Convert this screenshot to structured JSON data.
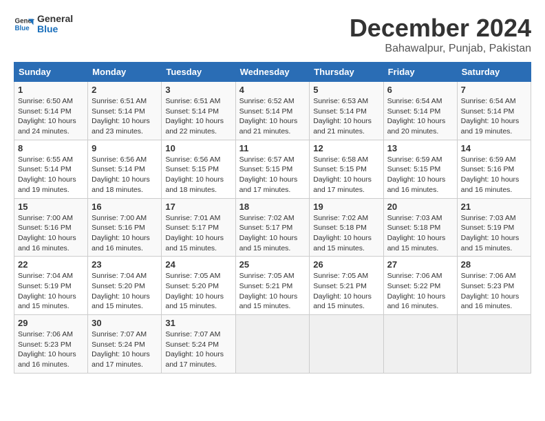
{
  "logo": {
    "line1": "General",
    "line2": "Blue"
  },
  "title": "December 2024",
  "location": "Bahawalpur, Punjab, Pakistan",
  "days_header": [
    "Sunday",
    "Monday",
    "Tuesday",
    "Wednesday",
    "Thursday",
    "Friday",
    "Saturday"
  ],
  "weeks": [
    [
      {
        "day": "1",
        "sunrise": "Sunrise: 6:50 AM",
        "sunset": "Sunset: 5:14 PM",
        "daylight": "Daylight: 10 hours and 24 minutes."
      },
      {
        "day": "2",
        "sunrise": "Sunrise: 6:51 AM",
        "sunset": "Sunset: 5:14 PM",
        "daylight": "Daylight: 10 hours and 23 minutes."
      },
      {
        "day": "3",
        "sunrise": "Sunrise: 6:51 AM",
        "sunset": "Sunset: 5:14 PM",
        "daylight": "Daylight: 10 hours and 22 minutes."
      },
      {
        "day": "4",
        "sunrise": "Sunrise: 6:52 AM",
        "sunset": "Sunset: 5:14 PM",
        "daylight": "Daylight: 10 hours and 21 minutes."
      },
      {
        "day": "5",
        "sunrise": "Sunrise: 6:53 AM",
        "sunset": "Sunset: 5:14 PM",
        "daylight": "Daylight: 10 hours and 21 minutes."
      },
      {
        "day": "6",
        "sunrise": "Sunrise: 6:54 AM",
        "sunset": "Sunset: 5:14 PM",
        "daylight": "Daylight: 10 hours and 20 minutes."
      },
      {
        "day": "7",
        "sunrise": "Sunrise: 6:54 AM",
        "sunset": "Sunset: 5:14 PM",
        "daylight": "Daylight: 10 hours and 19 minutes."
      }
    ],
    [
      {
        "day": "8",
        "sunrise": "Sunrise: 6:55 AM",
        "sunset": "Sunset: 5:14 PM",
        "daylight": "Daylight: 10 hours and 19 minutes."
      },
      {
        "day": "9",
        "sunrise": "Sunrise: 6:56 AM",
        "sunset": "Sunset: 5:14 PM",
        "daylight": "Daylight: 10 hours and 18 minutes."
      },
      {
        "day": "10",
        "sunrise": "Sunrise: 6:56 AM",
        "sunset": "Sunset: 5:15 PM",
        "daylight": "Daylight: 10 hours and 18 minutes."
      },
      {
        "day": "11",
        "sunrise": "Sunrise: 6:57 AM",
        "sunset": "Sunset: 5:15 PM",
        "daylight": "Daylight: 10 hours and 17 minutes."
      },
      {
        "day": "12",
        "sunrise": "Sunrise: 6:58 AM",
        "sunset": "Sunset: 5:15 PM",
        "daylight": "Daylight: 10 hours and 17 minutes."
      },
      {
        "day": "13",
        "sunrise": "Sunrise: 6:59 AM",
        "sunset": "Sunset: 5:15 PM",
        "daylight": "Daylight: 10 hours and 16 minutes."
      },
      {
        "day": "14",
        "sunrise": "Sunrise: 6:59 AM",
        "sunset": "Sunset: 5:16 PM",
        "daylight": "Daylight: 10 hours and 16 minutes."
      }
    ],
    [
      {
        "day": "15",
        "sunrise": "Sunrise: 7:00 AM",
        "sunset": "Sunset: 5:16 PM",
        "daylight": "Daylight: 10 hours and 16 minutes."
      },
      {
        "day": "16",
        "sunrise": "Sunrise: 7:00 AM",
        "sunset": "Sunset: 5:16 PM",
        "daylight": "Daylight: 10 hours and 16 minutes."
      },
      {
        "day": "17",
        "sunrise": "Sunrise: 7:01 AM",
        "sunset": "Sunset: 5:17 PM",
        "daylight": "Daylight: 10 hours and 15 minutes."
      },
      {
        "day": "18",
        "sunrise": "Sunrise: 7:02 AM",
        "sunset": "Sunset: 5:17 PM",
        "daylight": "Daylight: 10 hours and 15 minutes."
      },
      {
        "day": "19",
        "sunrise": "Sunrise: 7:02 AM",
        "sunset": "Sunset: 5:18 PM",
        "daylight": "Daylight: 10 hours and 15 minutes."
      },
      {
        "day": "20",
        "sunrise": "Sunrise: 7:03 AM",
        "sunset": "Sunset: 5:18 PM",
        "daylight": "Daylight: 10 hours and 15 minutes."
      },
      {
        "day": "21",
        "sunrise": "Sunrise: 7:03 AM",
        "sunset": "Sunset: 5:19 PM",
        "daylight": "Daylight: 10 hours and 15 minutes."
      }
    ],
    [
      {
        "day": "22",
        "sunrise": "Sunrise: 7:04 AM",
        "sunset": "Sunset: 5:19 PM",
        "daylight": "Daylight: 10 hours and 15 minutes."
      },
      {
        "day": "23",
        "sunrise": "Sunrise: 7:04 AM",
        "sunset": "Sunset: 5:20 PM",
        "daylight": "Daylight: 10 hours and 15 minutes."
      },
      {
        "day": "24",
        "sunrise": "Sunrise: 7:05 AM",
        "sunset": "Sunset: 5:20 PM",
        "daylight": "Daylight: 10 hours and 15 minutes."
      },
      {
        "day": "25",
        "sunrise": "Sunrise: 7:05 AM",
        "sunset": "Sunset: 5:21 PM",
        "daylight": "Daylight: 10 hours and 15 minutes."
      },
      {
        "day": "26",
        "sunrise": "Sunrise: 7:05 AM",
        "sunset": "Sunset: 5:21 PM",
        "daylight": "Daylight: 10 hours and 15 minutes."
      },
      {
        "day": "27",
        "sunrise": "Sunrise: 7:06 AM",
        "sunset": "Sunset: 5:22 PM",
        "daylight": "Daylight: 10 hours and 16 minutes."
      },
      {
        "day": "28",
        "sunrise": "Sunrise: 7:06 AM",
        "sunset": "Sunset: 5:23 PM",
        "daylight": "Daylight: 10 hours and 16 minutes."
      }
    ],
    [
      {
        "day": "29",
        "sunrise": "Sunrise: 7:06 AM",
        "sunset": "Sunset: 5:23 PM",
        "daylight": "Daylight: 10 hours and 16 minutes."
      },
      {
        "day": "30",
        "sunrise": "Sunrise: 7:07 AM",
        "sunset": "Sunset: 5:24 PM",
        "daylight": "Daylight: 10 hours and 17 minutes."
      },
      {
        "day": "31",
        "sunrise": "Sunrise: 7:07 AM",
        "sunset": "Sunset: 5:24 PM",
        "daylight": "Daylight: 10 hours and 17 minutes."
      },
      null,
      null,
      null,
      null
    ]
  ]
}
